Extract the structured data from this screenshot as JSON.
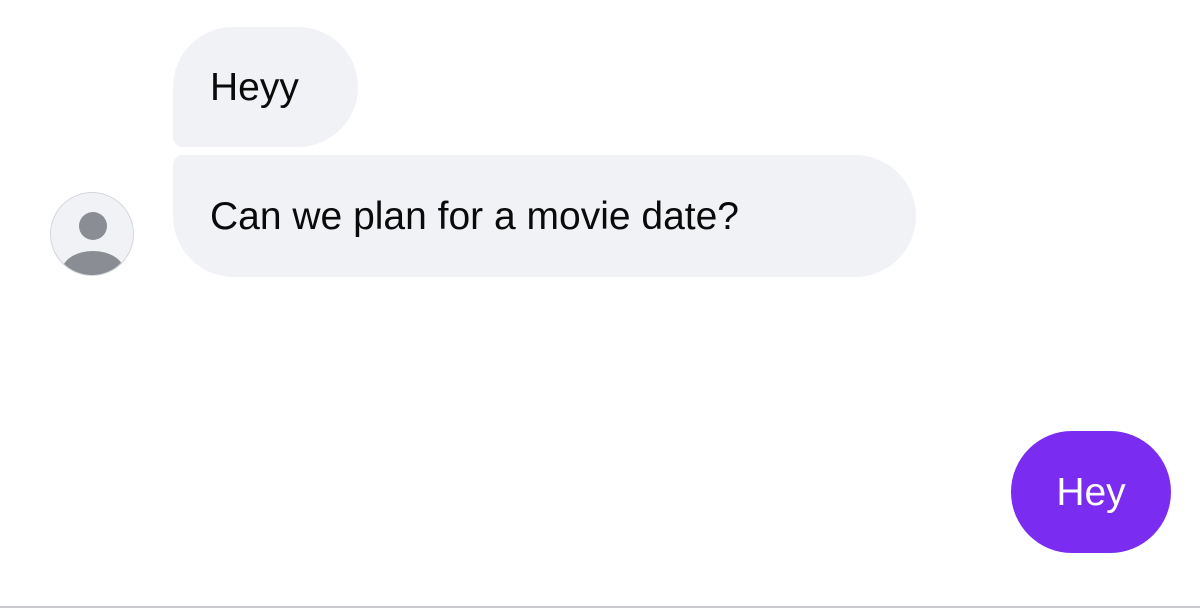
{
  "conversation": {
    "messages": [
      {
        "direction": "incoming",
        "text": "Heyy"
      },
      {
        "direction": "incoming",
        "text": "Can we plan for a movie date?"
      },
      {
        "direction": "outgoing",
        "text": "Hey"
      }
    ],
    "contact_avatar": {
      "icon": "default-user-icon"
    }
  },
  "colors": {
    "incoming_bubble": "#f0f2f5",
    "outgoing_bubble": "#7a2cf0",
    "incoming_text": "#0a0a0a",
    "outgoing_text": "#ffffff",
    "avatar_silhouette": "#8a8d93"
  }
}
